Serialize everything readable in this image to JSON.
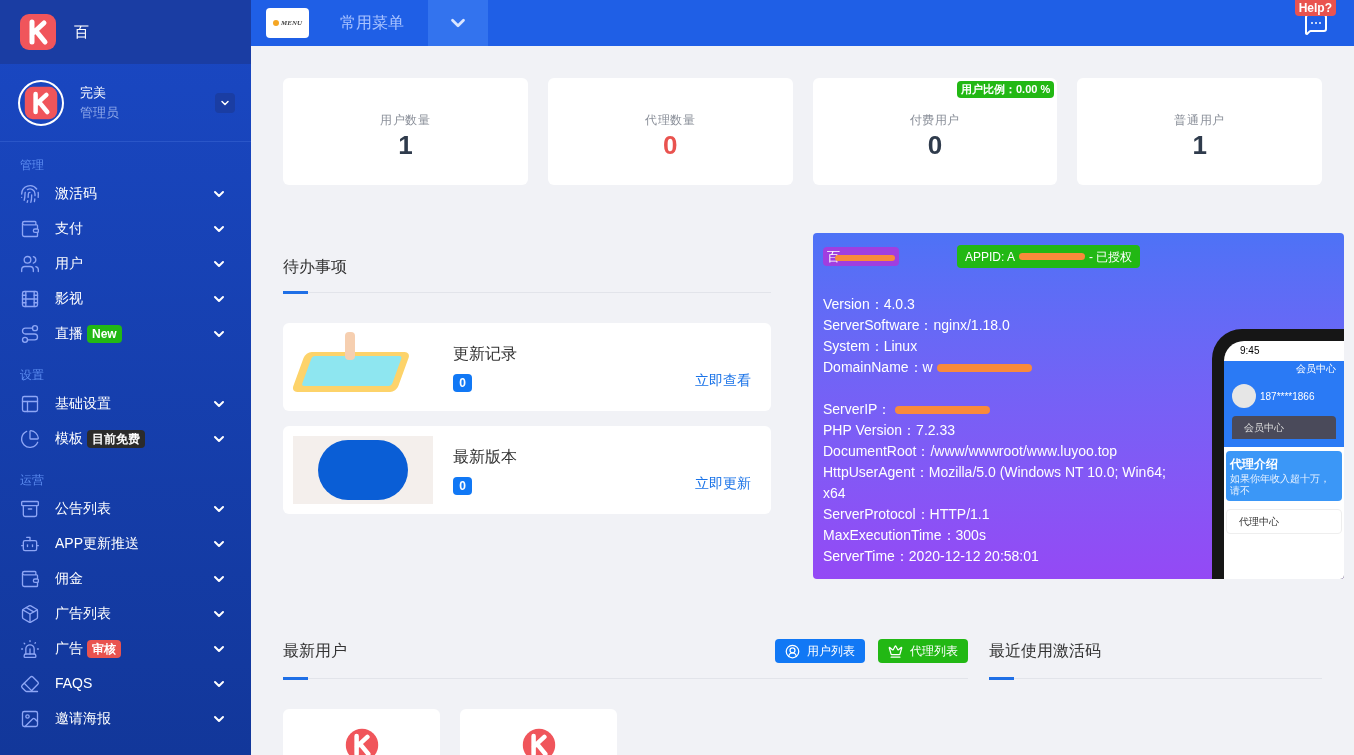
{
  "brand": {
    "name": "百"
  },
  "user": {
    "name": "完美",
    "role": "管理员"
  },
  "sidebar": {
    "sections": [
      {
        "title": "管理",
        "items": [
          {
            "label": "激活码"
          },
          {
            "label": "支付"
          },
          {
            "label": "用户"
          },
          {
            "label": "影视"
          },
          {
            "label": "直播",
            "badge": {
              "text": "New",
              "color": "#22b814"
            }
          }
        ]
      },
      {
        "title": "设置",
        "items": [
          {
            "label": "基础设置"
          },
          {
            "label": "模板",
            "badge": {
              "text": "目前免费",
              "color": "#2b2b2b"
            }
          }
        ]
      },
      {
        "title": "运营",
        "items": [
          {
            "label": "公告列表"
          },
          {
            "label": "APP更新推送"
          },
          {
            "label": "佣金"
          },
          {
            "label": "广告列表"
          },
          {
            "label": "广告",
            "badge": {
              "text": "审核",
              "color": "#e9534f"
            }
          },
          {
            "label": "FAQS"
          },
          {
            "label": "邀请海报"
          }
        ]
      }
    ]
  },
  "header": {
    "menu_logo_text": "MENU",
    "menu_title": "常用菜单",
    "help_badge": "Help?"
  },
  "stats": [
    {
      "label": "用户数量",
      "value": "1",
      "color": "#2f3b4c"
    },
    {
      "label": "代理数量",
      "value": "0",
      "color": "#e9534f"
    },
    {
      "label": "付费用户",
      "value": "0",
      "color": "#2f3b4c",
      "badge": "用户比例：0.00 %"
    },
    {
      "label": "普通用户",
      "value": "1",
      "color": "#2f3b4c"
    }
  ],
  "todo": {
    "title": "待办事项",
    "items": [
      {
        "title": "更新记录",
        "count": "0",
        "link": "立即查看"
      },
      {
        "title": "最新版本",
        "count": "0",
        "link": "立即更新"
      }
    ]
  },
  "server_card": {
    "site_badge": "百",
    "appid_prefix": "APPID: A",
    "appid_suffix": "- 已授权",
    "line_groups": [
      [
        "Version：4.0.3",
        "ServerSoftware：nginx/1.18.0",
        "System：Linux",
        "DomainName：w"
      ],
      [
        "ServerIP：",
        "PHP Version：7.2.33",
        "DocumentRoot：/www/wwwroot/www.luyoo.top",
        "HttpUserAgent：Mozilla/5.0 (Windows NT 10.0; Win64; x64",
        "ServerProtocol：HTTP/1.1",
        "MaxExecutionTime：300s",
        "ServerTime：2020-12-12 20:58:01"
      ]
    ],
    "phone": {
      "time": "9:45",
      "header": "会员中心",
      "phone_number": "187****1866",
      "member_bar": "会员中心",
      "promo_title": "代理介绍",
      "promo_text": "如果你年收入超十万，请不",
      "agent_center": "代理中心"
    }
  },
  "latest_users": {
    "title": "最新用户",
    "buttons": [
      "用户列表",
      "代理列表"
    ]
  },
  "recent_codes": {
    "title": "最近使用激活码"
  }
}
